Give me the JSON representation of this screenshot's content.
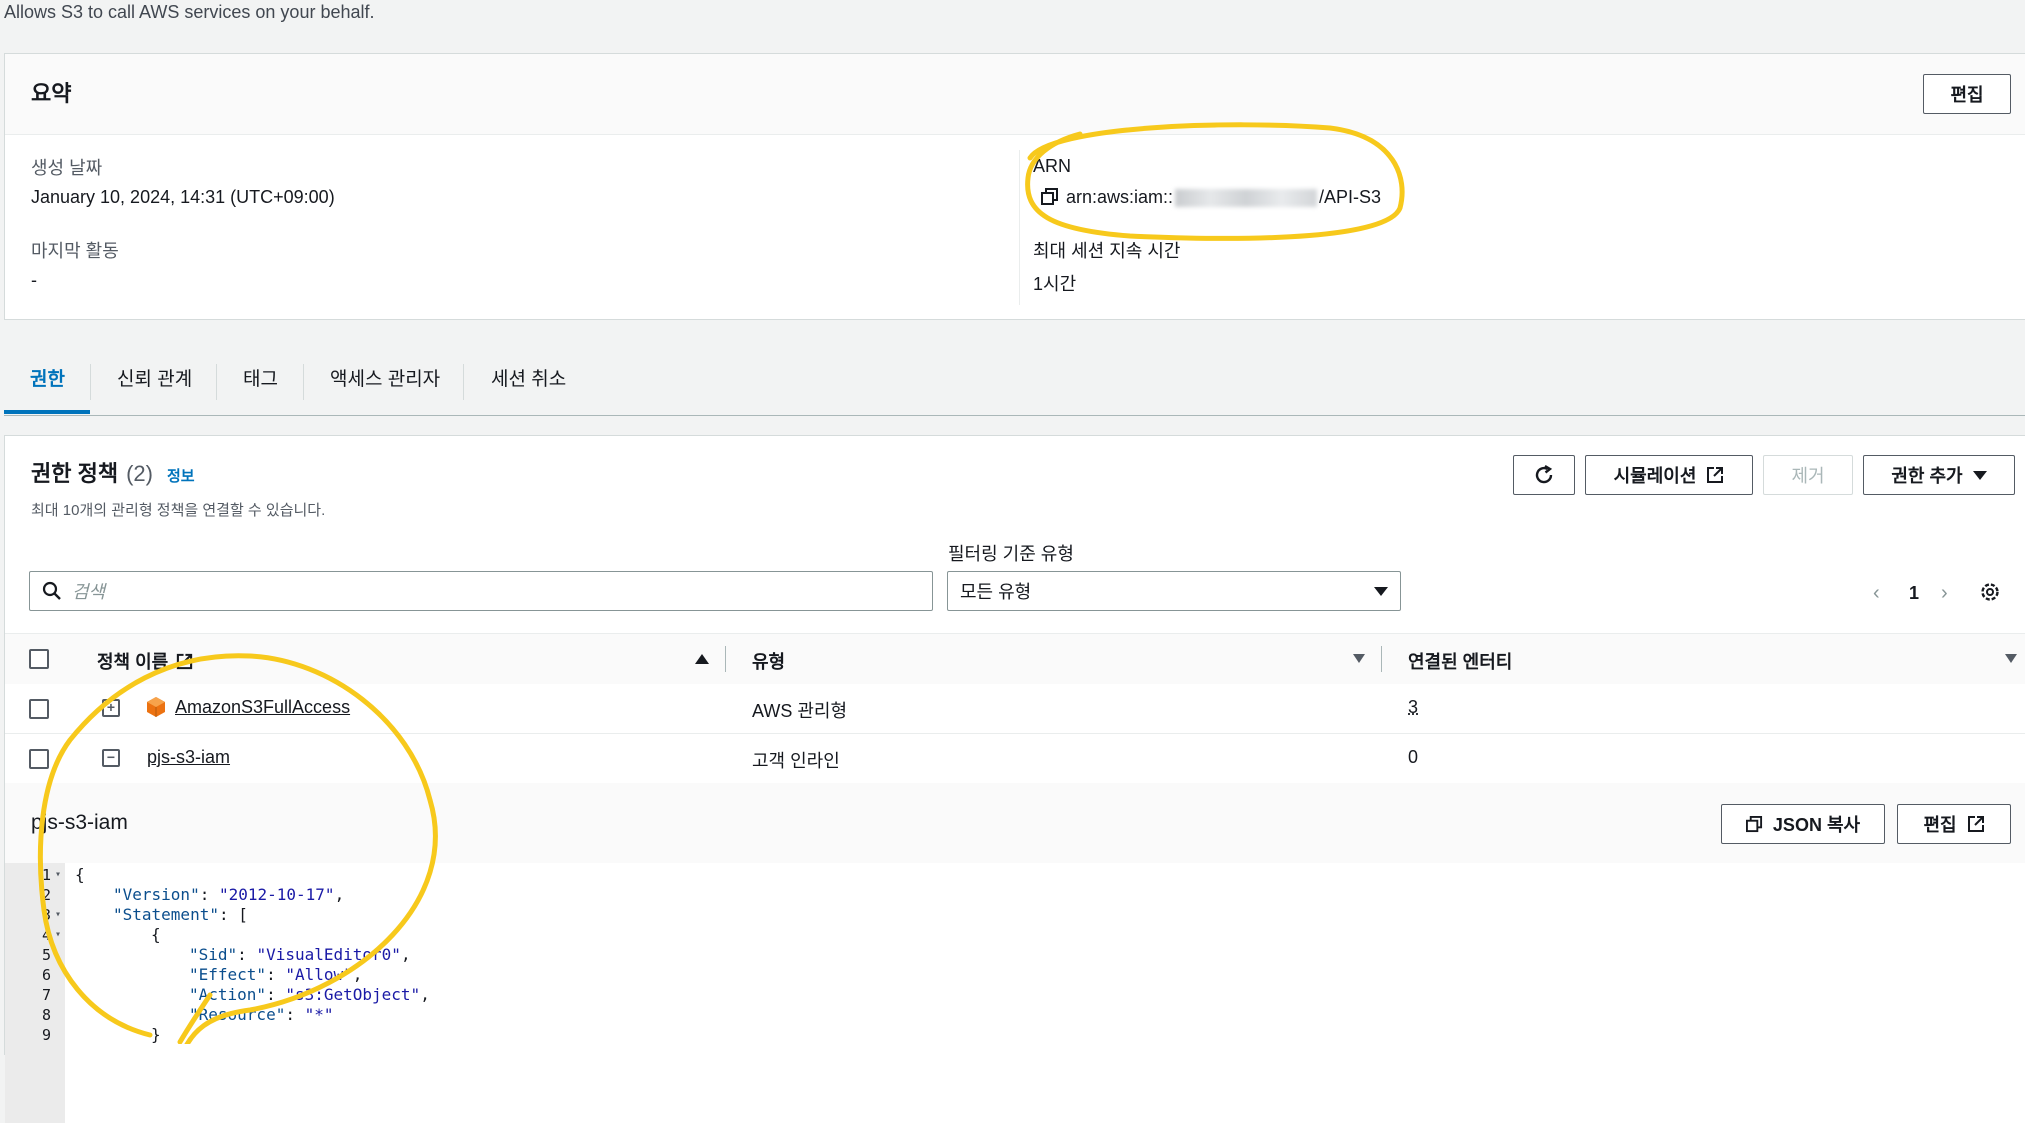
{
  "description": "Allows S3 to call AWS services on your behalf.",
  "summary": {
    "title": "요약",
    "edit_label": "편집",
    "created_label": "생성 날짜",
    "created_value": "January 10, 2024, 14:31 (UTC+09:00)",
    "last_activity_label": "마지막 활동",
    "last_activity_value": "-",
    "arn_label": "ARN",
    "arn_prefix": "arn:aws:iam::",
    "arn_suffix": "/API-S3",
    "session_label": "최대 세션 지속 시간",
    "session_value": "1시간"
  },
  "tabs": [
    "권한",
    "신뢰 관계",
    "태그",
    "액세스 관리자",
    "세션 취소"
  ],
  "policies": {
    "title": "권한 정책",
    "count": "(2)",
    "info_link": "정보",
    "subtitle": "최대 10개의 관리형 정책을 연결할 수 있습니다.",
    "simulation_label": "시뮬레이션",
    "remove_label": "제거",
    "add_label": "권한 추가",
    "filter_label": "필터링 기준 유형",
    "search_placeholder": "검색",
    "filter_value": "모든 유형",
    "page_number": "1",
    "columns": [
      "정책 이름",
      "유형",
      "연결된 엔터티"
    ],
    "rows": [
      {
        "name": "AmazonS3FullAccess",
        "type": "AWS 관리형",
        "entities": "3"
      },
      {
        "name": "pjs-s3-iam",
        "type": "고객 인라인",
        "entities": "0"
      }
    ]
  },
  "detail": {
    "title": "pjs-s3-iam",
    "copy_json_label": "JSON 복사",
    "edit_label": "편집",
    "line_numbers": [
      "1",
      "2",
      "3",
      "4",
      "5",
      "6",
      "7",
      "8",
      "9"
    ]
  },
  "code_lines": {
    "l1": "{",
    "l2_key": "\"Version\"",
    "l2_val": "\"2012-10-17\"",
    "l3_key": "\"Statement\"",
    "l3_rest": ": [",
    "l4": "{",
    "l5_key": "\"Sid\"",
    "l5_val": "\"VisualEditor0\"",
    "l6_key": "\"Effect\"",
    "l6_val": "\"Allow\"",
    "l7_key": "\"Action\"",
    "l7_val": "\"s3:GetObject\"",
    "l8_key": "\"Resource\"",
    "l8_val": "\"*\"",
    "l9": "}"
  },
  "colors": {
    "accent": "#0073bb",
    "highlight": "#f7c91c"
  }
}
